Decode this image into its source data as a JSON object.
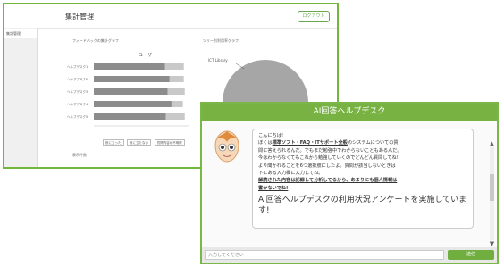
{
  "dashboard": {
    "title": "集計管理",
    "header_button": "ログアウト",
    "sidebar_item": "集計管理",
    "bar_panel_title": "フィードバックの集計グラフ",
    "pie_panel_title": "ツリー別利用率グラフ",
    "bar_chart_heading": "ユーザー",
    "footer_label": "表示件数",
    "legend": [
      "役に立った",
      "役に立たない",
      "質問内容が不明確"
    ],
    "pie_label": "ICT Library"
  },
  "chart_data": [
    {
      "type": "bar",
      "title": "ユーザー",
      "categories": [
        "ヘルプデスク1",
        "ヘルプデスク2",
        "ヘルプデスク3",
        "ヘルプデスク4",
        "ヘルプデスク5"
      ],
      "series": [
        {
          "name": "役に立った",
          "values": [
            75,
            80,
            78,
            82,
            76
          ]
        },
        {
          "name": "役に立たない",
          "values": [
            20,
            15,
            18,
            12,
            20
          ]
        }
      ],
      "xlim": [
        0,
        100
      ]
    },
    {
      "type": "pie",
      "values": [
        100
      ],
      "labels": [
        "ICT Library"
      ]
    }
  ],
  "chat": {
    "title": "AI回答ヘルプデスク",
    "greeting": "こんにちは!",
    "line1a": "ぼくは",
    "line1b": "標準ソフト・FAQ・ITサポート全般",
    "line1c": "のシステムについての質",
    "line2": "問に答えられるんだ。でもまだ勉強中でわからないこともあるんだ。",
    "line3": "今はわからなくてもこれから勉強していくのでどんどん質問してね!",
    "line4": "より聞かれることを6つ選択肢にしたよ。質問が該当しないときは",
    "line5": "下にある入力欄に入力してね。",
    "line6": "解読された内容は記録して分析してるから、あまりにも個人情報は",
    "line7": "書かないでね!",
    "survey": "AI回答ヘルプデスクの利用状況アンケートを実施しています!",
    "input_placeholder": "入力してください",
    "send_label": "送信"
  },
  "colors": {
    "accent_green": "#77b243",
    "bar_dark": "#8c8c8c",
    "bar_light": "#c9c9c9",
    "pie": "#a6a6a6"
  }
}
